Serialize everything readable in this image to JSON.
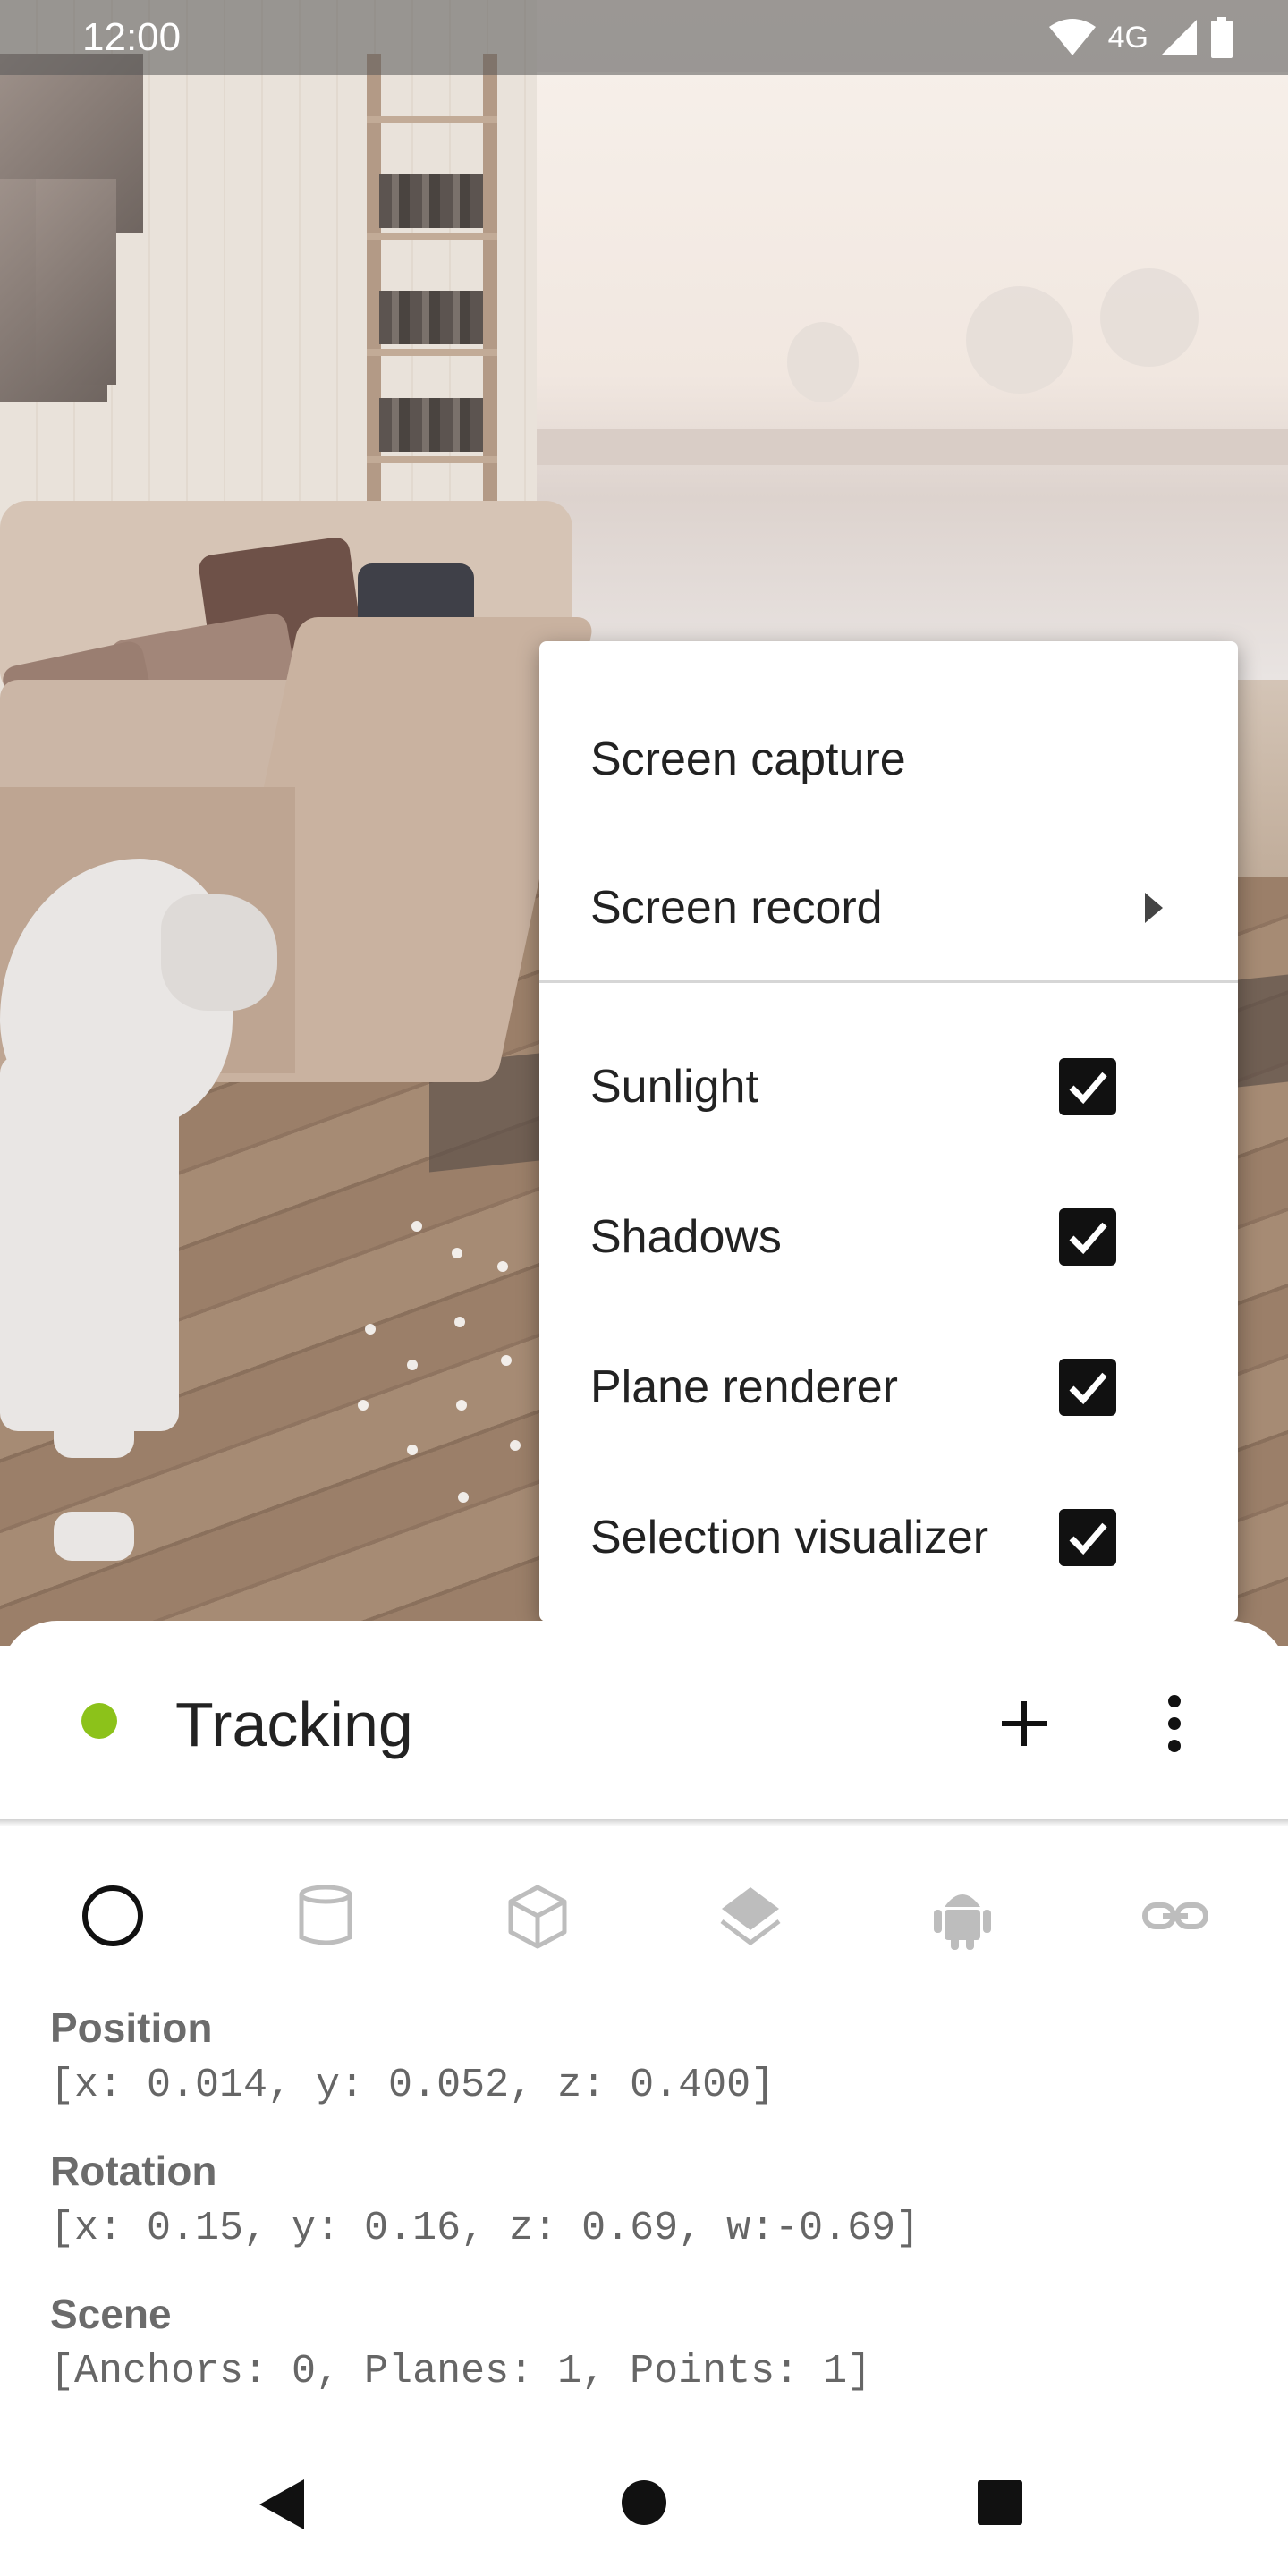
{
  "status_bar": {
    "time": "12:00",
    "network": "4G"
  },
  "menu": {
    "items": [
      {
        "label": "Screen capture"
      },
      {
        "label": "Screen record",
        "has_submenu": true
      },
      {
        "label": "Sunlight",
        "checked": true
      },
      {
        "label": "Shadows",
        "checked": true
      },
      {
        "label": "Plane renderer",
        "checked": true
      },
      {
        "label": "Selection visualizer",
        "checked": true
      }
    ]
  },
  "sheet": {
    "status": "Tracking",
    "status_color": "#8cc21a",
    "tabs": [
      "circle-icon",
      "cylinder-icon",
      "cube-icon",
      "layers-icon",
      "android-icon",
      "link-icon"
    ],
    "active_tab": 0,
    "info": {
      "position_label": "Position",
      "position_value": "[x: 0.014, y: 0.052, z: 0.400]",
      "rotation_label": "Rotation",
      "rotation_value": "[x: 0.15, y: 0.16, z: 0.69, w:-0.69]",
      "scene_label": "Scene",
      "scene_value": "[Anchors: 0, Planes: 1, Points: 1]"
    }
  },
  "nav": {
    "back": "back-icon",
    "home": "home-icon",
    "recents": "recents-icon"
  }
}
